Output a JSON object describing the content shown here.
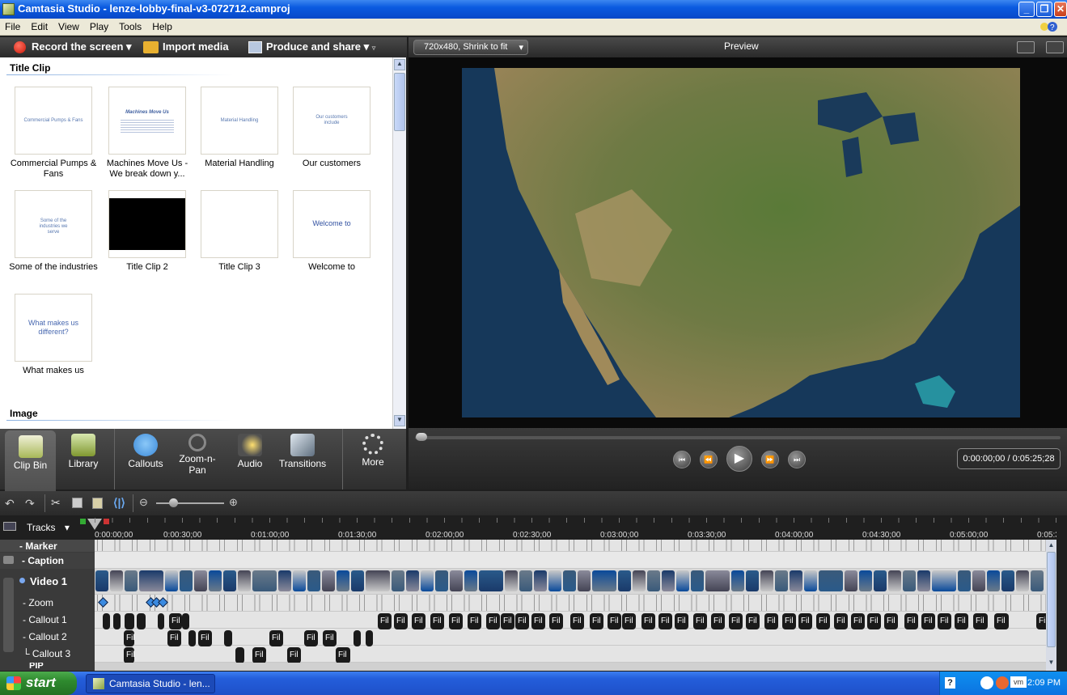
{
  "window": {
    "title": "Camtasia Studio - lenze-lobby-final-v3-072712.camproj",
    "minimize": "_",
    "maximize": "❐",
    "close": "✕"
  },
  "menu": [
    "File",
    "Edit",
    "View",
    "Play",
    "Tools",
    "Help"
  ],
  "toolbar": {
    "record": "Record the screen",
    "import": "Import media",
    "produce": "Produce and share"
  },
  "clipbin": {
    "section_title": "Title Clip",
    "section_image": "Image",
    "clips": [
      {
        "label": "Commercial Pumps & Fans",
        "thumb_text": "Commercial Pumps & Fans"
      },
      {
        "label": "Machines Move Us -We break down y...",
        "thumb_text": "Machines Move Us"
      },
      {
        "label": "Material Handling",
        "thumb_text": "Material Handling"
      },
      {
        "label": "Our customers",
        "thumb_text": "Our customers include"
      },
      {
        "label": "Some of the industries",
        "thumb_text": "Some of the industries we serve"
      },
      {
        "label": "Title Clip 2",
        "thumb_text": ""
      },
      {
        "label": "Title Clip 3",
        "thumb_text": ""
      },
      {
        "label": "Welcome to",
        "thumb_text": "Welcome to"
      },
      {
        "label": "What makes us",
        "thumb_text": "What makes us different?"
      }
    ]
  },
  "tabs": [
    {
      "label": "Clip Bin",
      "icon": "clip-bin-icon"
    },
    {
      "label": "Library",
      "icon": "library-icon"
    },
    {
      "label": "Callouts",
      "icon": "callouts-icon"
    },
    {
      "label": "Zoom-n-Pan",
      "icon": "zoom-icon"
    },
    {
      "label": "Audio",
      "icon": "audio-icon"
    },
    {
      "label": "Transitions",
      "icon": "transitions-icon"
    },
    {
      "label": "More",
      "icon": "more-icon"
    }
  ],
  "preview": {
    "size_option": "720x480, Shrink to fit",
    "title": "Preview",
    "timecode": "0:00:00;00 / 0:05:25;28"
  },
  "timeline": {
    "tracks_label": "Tracks",
    "ruler": [
      "0:00:00;00",
      "0:00:30;00",
      "0:01:00;00",
      "0:01:30;00",
      "0:02:00;00",
      "0:02:30;00",
      "0:03:00;00",
      "0:03:30;00",
      "0:04:00;00",
      "0:04:30;00",
      "0:05:00;00",
      "0:05:3"
    ],
    "rows": [
      "Marker",
      "Caption",
      "Video 1",
      "Zoom",
      "Callout 1",
      "Callout 2",
      "Callout 3",
      "PIP"
    ],
    "callout_text": "Fil"
  },
  "taskbar": {
    "start": "start",
    "item": "Camtasia Studio - len...",
    "clock": "2:09 PM"
  }
}
